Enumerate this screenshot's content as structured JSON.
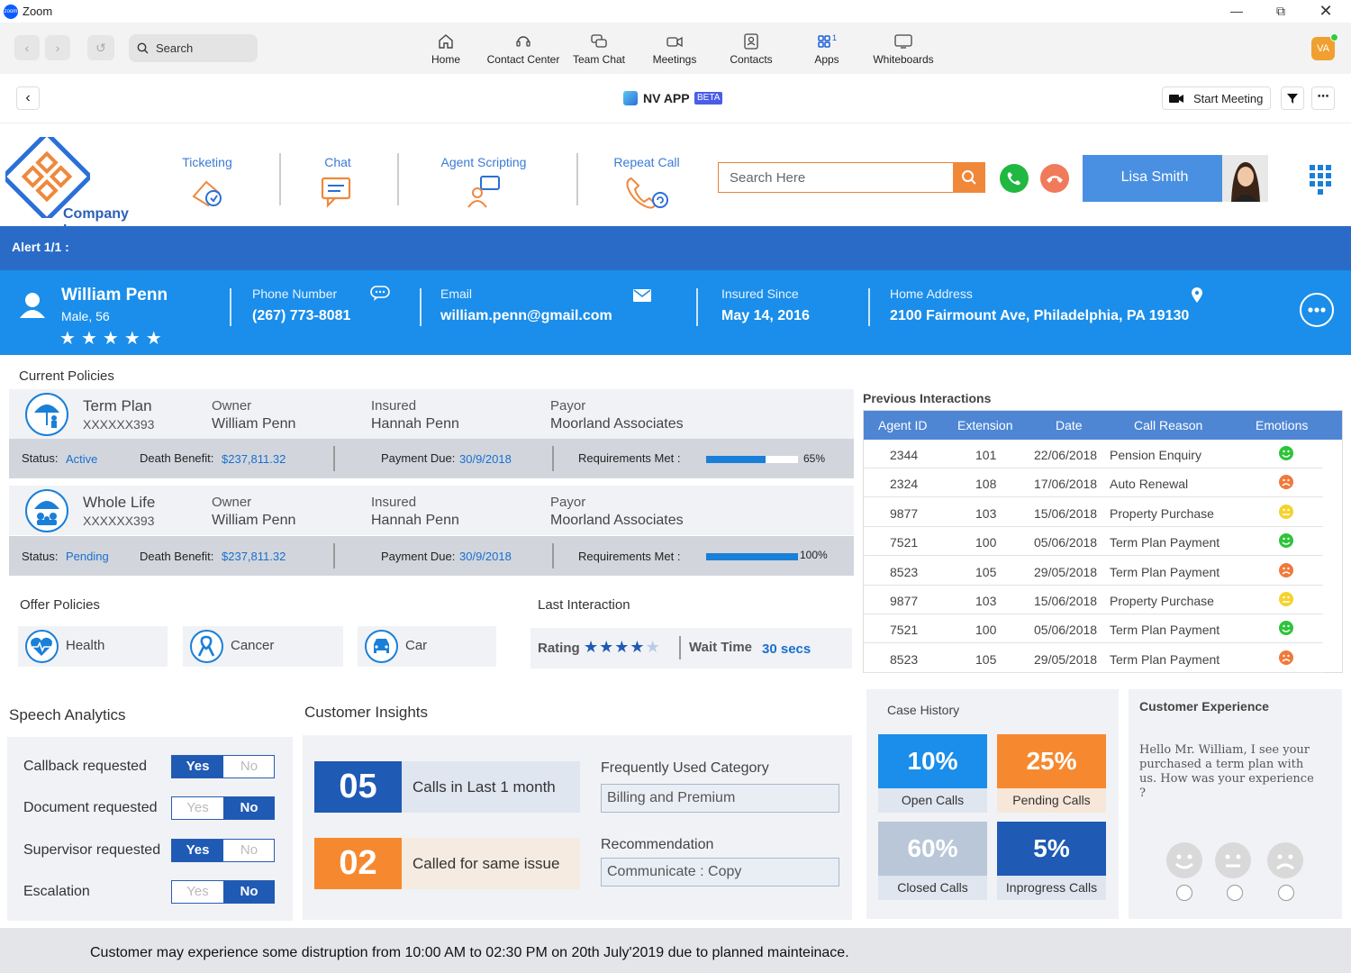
{
  "window": {
    "title": "Zoom"
  },
  "zoom_toolbar": {
    "search_label": "Search",
    "tabs": [
      {
        "label": "Home",
        "icon": "home-icon"
      },
      {
        "label": "Contact Center",
        "icon": "contact-center-icon"
      },
      {
        "label": "Team Chat",
        "icon": "team-chat-icon"
      },
      {
        "label": "Meetings",
        "icon": "meetings-icon"
      },
      {
        "label": "Contacts",
        "icon": "contacts-icon"
      },
      {
        "label": "Apps",
        "icon": "apps-icon"
      },
      {
        "label": "Whiteboards",
        "icon": "whiteboards-icon"
      }
    ],
    "avatar_initials": "VA"
  },
  "app_header": {
    "app_name": "NV APP",
    "badge": "BETA",
    "start_meeting_label": "Start Meeting"
  },
  "brand": {
    "logo_text": "Company Logo",
    "tools": [
      {
        "label": "Ticketing",
        "icon": "ticketing-icon"
      },
      {
        "label": "Chat",
        "icon": "chat-icon"
      },
      {
        "label": "Agent Scripting",
        "icon": "agent-scripting-icon"
      },
      {
        "label": "Repeat Call",
        "icon": "repeat-call-icon"
      }
    ],
    "search_placeholder": "Search Here",
    "agent_name": "Lisa Smith"
  },
  "alert": {
    "text": "Alert 1/1 :"
  },
  "customer": {
    "name": "William Penn",
    "details": "Male, 56",
    "rating": 5,
    "phone_label": "Phone Number",
    "phone": "(267) 773-8081",
    "email_label": "Email",
    "email": "william.penn@gmail.com",
    "insured_since_label": "Insured Since",
    "insured_since": "May 14, 2016",
    "address_label": "Home Address",
    "address": "2100 Fairmount Ave, Philadelphia, PA 19130"
  },
  "current_policies": {
    "heading": "Current Policies",
    "owner_label": "Owner",
    "insured_label": "Insured",
    "payor_label": "Payor",
    "status_label": "Status:",
    "death_benefit_label": "Death Benefit:",
    "payment_due_label": "Payment Due:",
    "requirements_label": "Requirements Met :",
    "items": [
      {
        "plan": "Term Plan",
        "number": "XXXXXX393",
        "owner": "William Penn",
        "insured": "Hannah Penn",
        "payor": "Moorland Associates",
        "status": "Active",
        "death_benefit": "$237,811.32",
        "payment_due": "30/9/2018",
        "requirements_text": "65%",
        "requirements": 0.65
      },
      {
        "plan": "Whole Life",
        "number": "XXXXXX393",
        "owner": "William Penn",
        "insured": "Hannah Penn",
        "payor": "Moorland Associates",
        "status": "Pending",
        "death_benefit": "$237,811.32",
        "payment_due": "30/9/2018",
        "requirements_text": "100%",
        "requirements": 1.0
      }
    ]
  },
  "offer_policies": {
    "heading": "Offer Policies",
    "items": [
      {
        "label": "Health",
        "icon": "health-icon"
      },
      {
        "label": "Cancer",
        "icon": "cancer-ribbon-icon"
      },
      {
        "label": "Car",
        "icon": "car-icon"
      }
    ]
  },
  "last_interaction": {
    "heading": "Last Interaction",
    "rating_label": "Rating",
    "rating": 4,
    "wait_label": "Wait Time",
    "wait_value": "30 secs"
  },
  "previous_interactions": {
    "heading": "Previous Interactions",
    "columns": [
      "Agent ID",
      "Extension",
      "Date",
      "Call Reason",
      "Emotions"
    ],
    "rows": [
      {
        "agent": "2344",
        "ext": "101",
        "date": "22/06/2018",
        "reason": "Pension Enquiry",
        "emotion": "happy",
        "color": "#2ec43a"
      },
      {
        "agent": "2324",
        "ext": "108",
        "date": "17/06/2018",
        "reason": "Auto Renewal",
        "emotion": "sad",
        "color": "#f07a3a"
      },
      {
        "agent": "9877",
        "ext": "103",
        "date": "15/06/2018",
        "reason": "Property Purchase",
        "emotion": "neutral",
        "color": "#f5d22e"
      },
      {
        "agent": "7521",
        "ext": "100",
        "date": "05/06/2018",
        "reason": "Term Plan Payment",
        "emotion": "happy",
        "color": "#2ec43a"
      },
      {
        "agent": "8523",
        "ext": "105",
        "date": "29/05/2018",
        "reason": "Term Plan Payment",
        "emotion": "sad",
        "color": "#f07a3a"
      },
      {
        "agent": "9877",
        "ext": "103",
        "date": "15/06/2018",
        "reason": "Property Purchase",
        "emotion": "neutral",
        "color": "#f5d22e"
      },
      {
        "agent": "7521",
        "ext": "100",
        "date": "05/06/2018",
        "reason": "Term Plan Payment",
        "emotion": "happy",
        "color": "#2ec43a"
      },
      {
        "agent": "8523",
        "ext": "105",
        "date": "29/05/2018",
        "reason": "Term Plan Payment",
        "emotion": "sad",
        "color": "#f07a3a"
      }
    ]
  },
  "speech_analytics": {
    "heading": "Speech Analytics",
    "yes_label": "Yes",
    "no_label": "No",
    "items": [
      {
        "label": "Callback requested",
        "value": "Yes"
      },
      {
        "label": "Document requested",
        "value": "No"
      },
      {
        "label": "Supervisor requested",
        "value": "Yes"
      },
      {
        "label": "Escalation",
        "value": "No"
      }
    ]
  },
  "customer_insights": {
    "heading": "Customer Insights",
    "calls_count": "05",
    "calls_label": "Calls in Last 1 month",
    "same_issue_count": "02",
    "same_issue_label": "Called for same issue",
    "category_label": "Frequently Used Category",
    "category_value": "Billing and Premium",
    "recommendation_label": "Recommendation",
    "recommendation_value": "Communicate : Copy"
  },
  "case_history": {
    "heading": "Case History",
    "tiles": [
      {
        "value": "10%",
        "label": "Open Calls",
        "color": "#1a8eea",
        "bg": "#dfe6f0"
      },
      {
        "value": "25%",
        "label": "Pending Calls",
        "color": "#f6892f",
        "bg": "#f7e7d8"
      },
      {
        "value": "60%",
        "label": "Closed Calls",
        "color": "#b9c7d8",
        "bg": "#dfe6f0"
      },
      {
        "value": "5%",
        "label": "Inprogress Calls",
        "color": "#1f5ab4",
        "bg": "#dfe6f0"
      }
    ]
  },
  "customer_experience": {
    "heading": "Customer Experience",
    "message": "Hello Mr. William, I see your purchased a term plan with us. How was your experience ?"
  },
  "footer": {
    "notice": "Customer may experience some distruption from 10:00 AM to 02:30 PM on 20th July'2019 due to planned mainteinace."
  }
}
